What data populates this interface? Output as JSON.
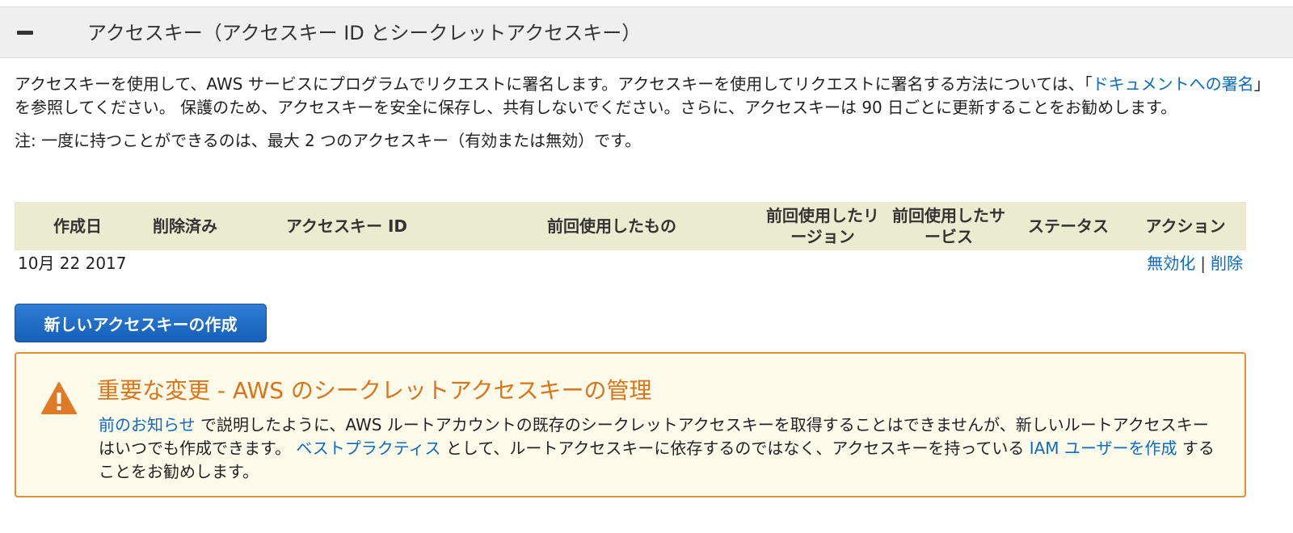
{
  "section": {
    "title": "アクセスキー（アクセスキー ID とシークレットアクセスキー）",
    "collapse_icon": "minus-icon"
  },
  "description": {
    "part1": "アクセスキーを使用して、AWS サービスにプログラムでリクエストに署名します。アクセスキーを使用してリクエストに署名する方法については、「",
    "link": "ドキュメントへの署名",
    "part2": "」を参照してください。 保護のため、アクセスキーを安全に保存し、共有しないでください。さらに、アクセスキーは 90 日ごとに更新することをお勧めします。"
  },
  "note": "注: 一度に持つことができるのは、最大 2 つのアクセスキー（有効または無効）です。",
  "table": {
    "headers": {
      "created": "作成日",
      "deleted": "削除済み",
      "access_key_id": "アクセスキー ID",
      "last_used": "前回使用したもの",
      "last_region": "前回使用したリージョン",
      "last_service": "前回使用したサービス",
      "status": "ステータス",
      "actions": "アクション"
    },
    "rows": [
      {
        "created": "10月 22 2017",
        "deleted": "",
        "access_key_id": "",
        "last_used": "",
        "last_region": "",
        "last_service": "",
        "status": "",
        "action_disable": "無効化",
        "action_separator": "|",
        "action_delete": "削除"
      }
    ]
  },
  "create_button": "新しいアクセスキーの作成",
  "notice": {
    "icon": "warning-icon",
    "title": "重要な変更 - AWS のシークレットアクセスキーの管理",
    "link1": "前のお知らせ",
    "text1": " で説明したように、AWS ルートアカウントの既存のシークレットアクセスキーを取得することはできませんが、新しいルートアクセスキーはいつでも作成できます。 ",
    "link2": "ベストプラクティス",
    "text2": " として、ルートアクセスキーに依存するのではなく、アクセスキーを持っている ",
    "link3": "IAM ユーザーを作成",
    "text3": " することをお勧めします。",
    "accent_color": "#dd7318",
    "border_color": "#e0913a"
  },
  "colors": {
    "link": "#0a6bc0",
    "table_header_bg": "#ebeccf",
    "button_bg": "#1560b8"
  }
}
